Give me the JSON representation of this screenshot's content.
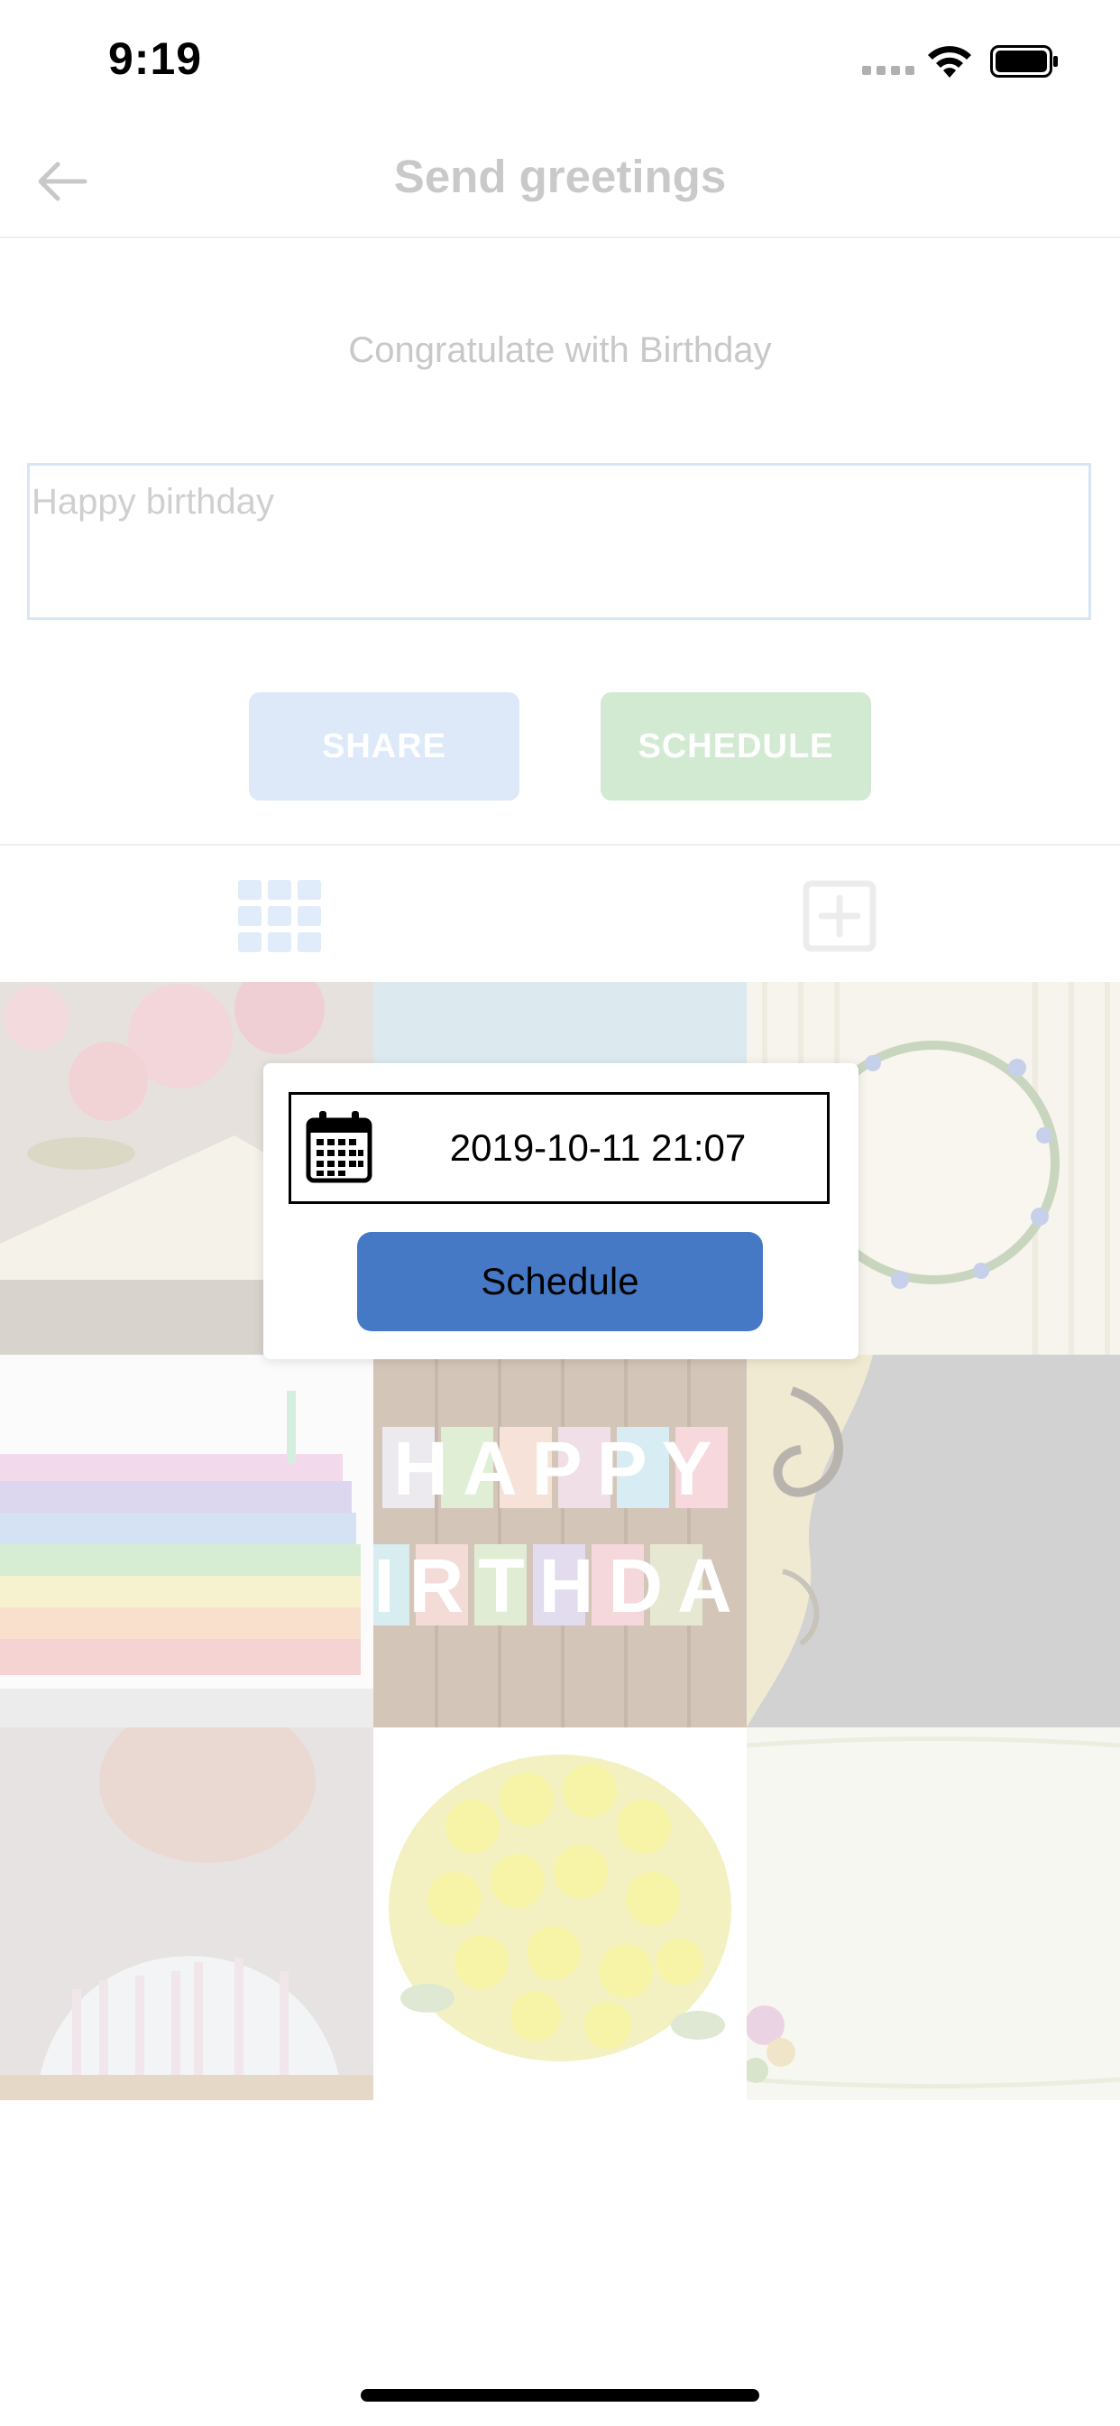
{
  "status_bar": {
    "time": "9:19"
  },
  "nav": {
    "title": "Send greetings"
  },
  "subtitle": "Congratulate with Birthday",
  "message": {
    "value": "Happy birthday"
  },
  "actions": {
    "share_label": "SHARE",
    "schedule_label": "SCHEDULE"
  },
  "tabs": [
    {
      "icon": "grid-icon",
      "active": true
    },
    {
      "icon": "plus-square-icon",
      "active": false
    }
  ],
  "gallery": {
    "tiles": [
      {
        "name": "pink-roses-envelope"
      },
      {
        "name": "blue-background"
      },
      {
        "name": "floral-wreath"
      },
      {
        "name": "rainbow-cake"
      },
      {
        "name": "happy-birthday-letters",
        "text_top": "HAPPY",
        "text_bottom": "IRTHDA"
      },
      {
        "name": "gold-swirl-dark"
      },
      {
        "name": "girl-with-candles"
      },
      {
        "name": "yellow-roses"
      },
      {
        "name": "cream-paper-flowers"
      }
    ]
  },
  "dialog": {
    "datetime": "2019-10-11 21:07",
    "button_label": "Schedule"
  },
  "colors": {
    "primary_blue": "#4579c6",
    "share_bg": "#dde9f9",
    "schedule_bg": "#d3ead2",
    "title_gray": "#c9c9c9"
  }
}
